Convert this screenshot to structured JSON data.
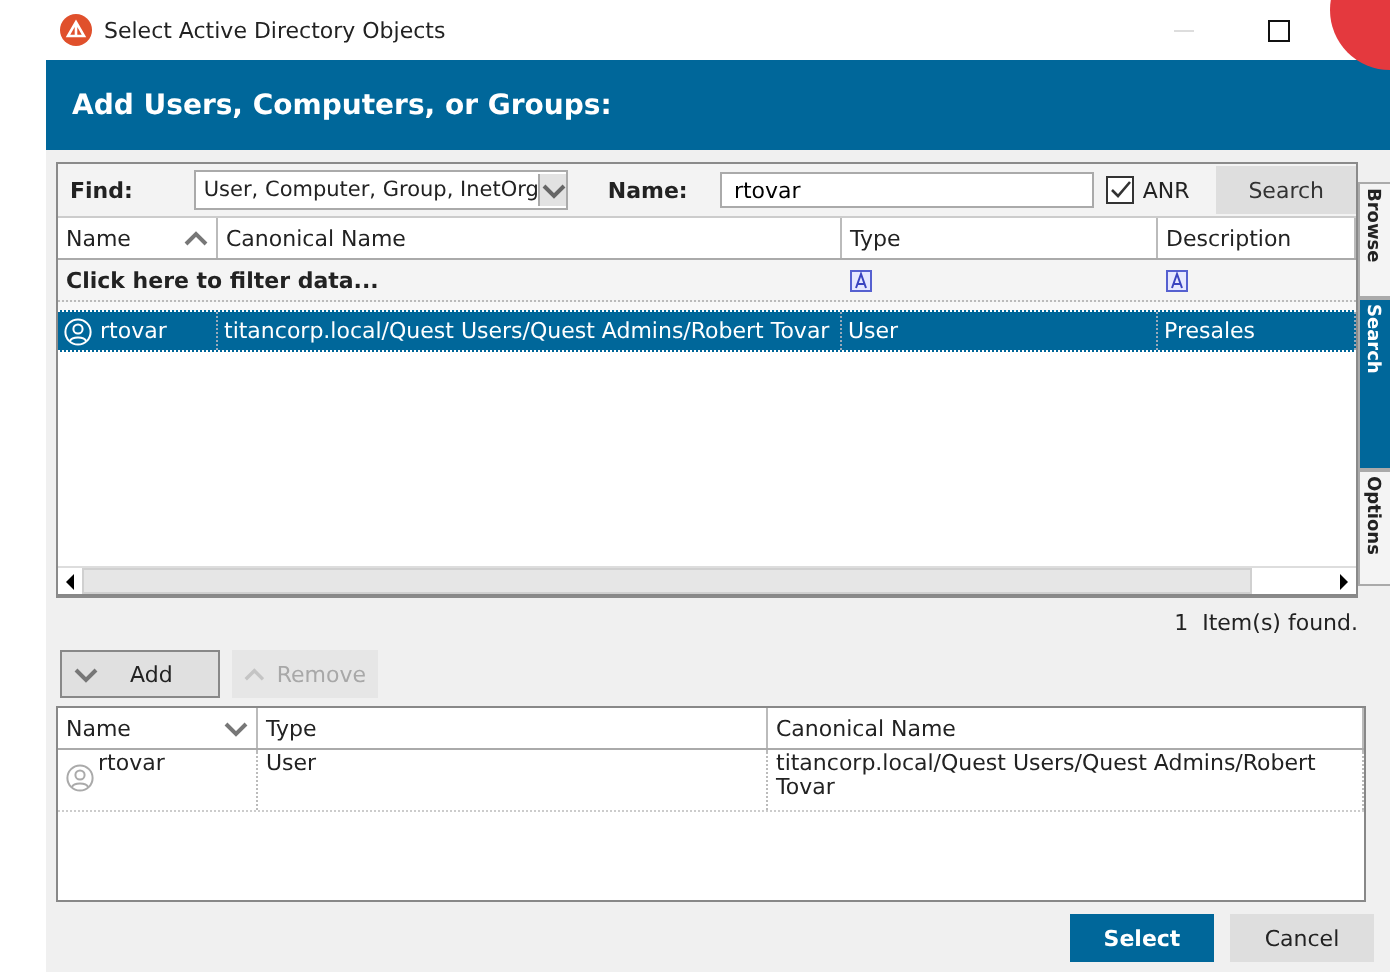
{
  "window": {
    "title": "Select Active Directory Objects"
  },
  "header": "Add Users, Computers, or Groups:",
  "find": {
    "label": "Find:",
    "value": "User, Computer, Group, InetOrg"
  },
  "name_field": {
    "label": "Name:",
    "value": "rtovar"
  },
  "anr": {
    "label": "ANR",
    "checked": true
  },
  "search_button": "Search",
  "results": {
    "columns": [
      {
        "label": "Name",
        "sorted": true,
        "descending": false
      },
      {
        "label": "Canonical Name"
      },
      {
        "label": "Type",
        "filter": true
      },
      {
        "label": "Description",
        "filter": true
      }
    ],
    "filter_text": "Click here to filter data...",
    "rows": [
      {
        "name": "rtovar",
        "canonical_name": "titancorp.local/Quest Users/Quest Admins/Robert Tovar",
        "type": "User",
        "description": "Presales",
        "selected": true
      }
    ]
  },
  "count": "1",
  "found_label": "Item(s) found.",
  "buttons": [
    {
      "label": "Add",
      "kind": "down",
      "disabled": false
    },
    {
      "label": "Remove",
      "kind": "up",
      "disabled": true
    }
  ],
  "selected_list": {
    "columns": [
      {
        "label": "Name",
        "sorted": true,
        "descending": true
      },
      {
        "label": "Type"
      },
      {
        "label": "Canonical Name"
      }
    ],
    "rows": [
      {
        "name": "rtovar",
        "type": "User",
        "canonical_name": "titancorp.local/Quest Users/Quest Admins/Robert Tovar"
      }
    ]
  },
  "side_tabs": [
    {
      "label": "Browse",
      "selected": false
    },
    {
      "label": "Search",
      "selected": true
    },
    {
      "label": "Options",
      "selected": false
    }
  ],
  "footer_buttons": [
    {
      "label": "Select",
      "kind": "primary"
    },
    {
      "label": "Cancel",
      "kind": "secondary"
    }
  ]
}
